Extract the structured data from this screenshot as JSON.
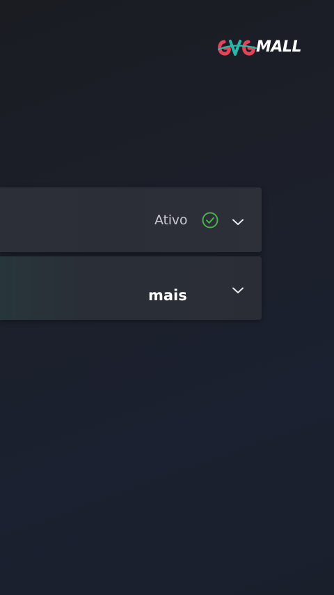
{
  "logo": {
    "prefix": "GVG",
    "suffix": "MALL",
    "colors": {
      "accent": "#e0455a",
      "teal": "#2ab7a9",
      "text": "#ffffff"
    }
  },
  "rows": [
    {
      "status": "Ativo",
      "status_icon": "check-circle-icon",
      "status_color": "#4caf50",
      "expand_icon": "chevron-down-icon"
    },
    {
      "label": "mais",
      "expand_icon": "chevron-down-icon"
    }
  ]
}
